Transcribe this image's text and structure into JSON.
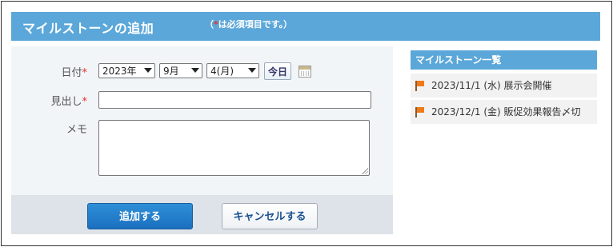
{
  "header": {
    "title": "マイルストーンの追加",
    "note_open": "（",
    "note_asterisk": "*",
    "note_text": "は必須項目です。）"
  },
  "form": {
    "date_label": "日付",
    "required_mark": "*",
    "year_value": "2023年",
    "month_value": "9月",
    "day_value": "4(月)",
    "today_button": "今日",
    "calendar_icon": "calendar-icon",
    "heading_label": "見出し",
    "heading_value": "",
    "memo_label": "メモ",
    "memo_value": ""
  },
  "buttons": {
    "add_label": "追加する",
    "cancel_label": "キャンセルする"
  },
  "sidebar": {
    "title": "マイルストーン一覧",
    "items": [
      {
        "label": "2023/11/1 (水) 展示会開催",
        "icon": "flag-icon"
      },
      {
        "label": "2023/12/1 (金) 販促効果報告〆切",
        "icon": "flag-icon"
      }
    ]
  },
  "colors": {
    "header_bg": "#5ba7d9",
    "required": "#e03030",
    "primary_button": "#1a6fbf",
    "flag": "#f07a1a"
  }
}
